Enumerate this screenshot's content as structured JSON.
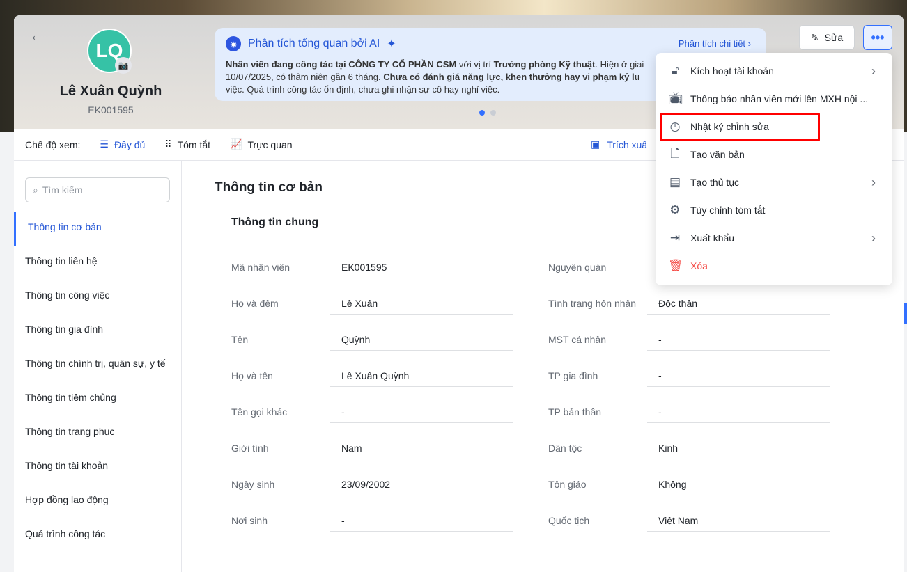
{
  "header": {
    "back_icon": "arrow-left-icon",
    "initials": "LQ",
    "name": "Lê Xuân Quỳnh",
    "code": "EK001595",
    "edit_label": "Sửa",
    "more_label": "•••"
  },
  "ai": {
    "title": "Phân tích tổng quan bởi AI",
    "detail_link": "Phân tích chi tiết",
    "line1_b1": "Nhân viên đang công tác tại CÔNG TY CỔ PHẦN CSM",
    "line1_t1": " với vị trí ",
    "line1_b2": "Trưởng phòng Kỹ thuật",
    "line1_t2": ". Hiện ở giai",
    "line2_t1": "10/07/2025, có thâm niên gần 6 tháng. ",
    "line2_b1": "Chưa có đánh giá năng lực, khen thưởng hay vi phạm kỷ lu",
    "line3": "việc. Quá trình công tác ổn định, chưa ghi nhận sự cố hay nghỉ việc."
  },
  "toolbar": {
    "view_label": "Chế độ xem:",
    "modes": [
      "Đầy đủ",
      "Tóm tắt",
      "Trực quan"
    ],
    "extract": "Trích xuấ"
  },
  "sidebar": {
    "search_placeholder": "Tìm kiếm",
    "items": [
      "Thông tin cơ bản",
      "Thông tin liên hệ",
      "Thông tin công việc",
      "Thông tin gia đình",
      "Thông tin chính trị, quân sự, y tế",
      "Thông tin tiêm chủng",
      "Thông tin trang phục",
      "Thông tin tài khoản",
      "Hợp đồng lao động",
      "Quá trình công tác"
    ]
  },
  "main": {
    "title": "Thông tin cơ bản",
    "section": "Thông tin chung",
    "left": [
      [
        "Mã nhân viên",
        "EK001595"
      ],
      [
        "Họ và đệm",
        "Lê Xuân"
      ],
      [
        "Tên",
        "Quỳnh"
      ],
      [
        "Họ và tên",
        "Lê Xuân Quỳnh"
      ],
      [
        "Tên gọi khác",
        "-"
      ],
      [
        "Giới tính",
        "Nam"
      ],
      [
        "Ngày sinh",
        "23/09/2002"
      ],
      [
        "Nơi sinh",
        "-"
      ]
    ],
    "right": [
      [
        "Nguyên quán",
        ""
      ],
      [
        "Tình trạng hôn nhân",
        "Độc thân"
      ],
      [
        "MST cá nhân",
        "-"
      ],
      [
        "TP gia đình",
        "-"
      ],
      [
        "TP bản thân",
        "-"
      ],
      [
        "Dân tộc",
        "Kinh"
      ],
      [
        "Tôn giáo",
        "Không"
      ],
      [
        "Quốc tịch",
        "Việt Nam"
      ]
    ]
  },
  "menu": [
    {
      "label": "Kích hoạt tài khoản",
      "icon": "unlock-icon",
      "sub": true
    },
    {
      "label": "Thông báo nhân viên mới lên MXH nội ...",
      "icon": "tv-icon",
      "sub": false
    },
    {
      "label": "Nhật ký chỉnh sửa",
      "icon": "clock-icon",
      "sub": false
    },
    {
      "label": "Tạo văn bản",
      "icon": "file-icon",
      "sub": false
    },
    {
      "label": "Tạo thủ tục",
      "icon": "inbox-icon",
      "sub": true
    },
    {
      "label": "Tùy chỉnh tóm tắt",
      "icon": "gear-icon",
      "sub": false
    },
    {
      "label": "Xuất khẩu",
      "icon": "export-icon",
      "sub": true
    },
    {
      "label": "Xóa",
      "icon": "trash-icon",
      "sub": false,
      "danger": true
    }
  ],
  "colors": {
    "accent": "#3370ff",
    "danger": "#f54a45",
    "highlight": "#ff0000",
    "avatar": "#36c2a6"
  }
}
